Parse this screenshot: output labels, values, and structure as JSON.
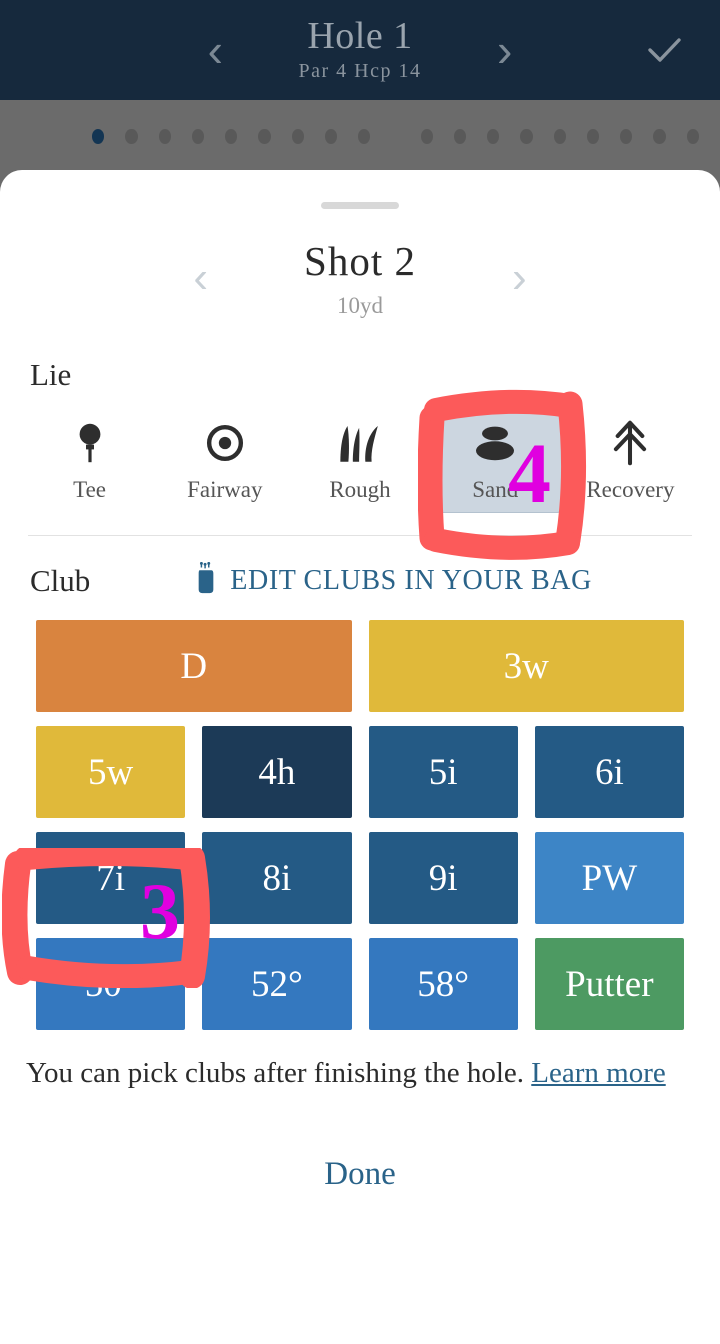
{
  "header": {
    "hole_title": "Hole 1",
    "hole_sub": "Par 4  Hcp 14",
    "prev_icon": "chevron-left-icon",
    "next_icon": "chevron-right-icon",
    "confirm_icon": "check-icon",
    "bg_color": "#16293d",
    "text_color": "#9aa4ae"
  },
  "pager": {
    "total_front": 9,
    "total_back": 9,
    "active_index": 0,
    "active_color": "#133553",
    "inactive_color": "#595959"
  },
  "sheet": {
    "shot": {
      "title": "Shot 2",
      "distance": "10yd",
      "prev_icon": "chevron-left-icon",
      "next_icon": "chevron-right-icon"
    },
    "lie": {
      "label": "Lie",
      "selected": "Sand",
      "options": [
        {
          "label": "Tee",
          "icon": "golf-tee-icon"
        },
        {
          "label": "Fairway",
          "icon": "target-circle-icon"
        },
        {
          "label": "Rough",
          "icon": "grass-icon"
        },
        {
          "label": "Sand",
          "icon": "sand-bunker-icon"
        },
        {
          "label": "Recovery",
          "icon": "pine-tree-icon"
        }
      ]
    },
    "club": {
      "label": "Club",
      "edit_link": "EDIT CLUBS IN YOUR BAG",
      "edit_icon": "golf-bag-icon",
      "edit_color": "#2a6389",
      "rows": [
        [
          {
            "label": "D",
            "color": "#d9843f"
          },
          {
            "label": "3w",
            "color": "#e0b93a"
          }
        ],
        [
          {
            "label": "5w",
            "color": "#e0b93a"
          },
          {
            "label": "4h",
            "color": "#1c3a57"
          },
          {
            "label": "5i",
            "color": "#245a85"
          },
          {
            "label": "6i",
            "color": "#245a85"
          }
        ],
        [
          {
            "label": "7i",
            "color": "#245a85"
          },
          {
            "label": "8i",
            "color": "#245a85"
          },
          {
            "label": "9i",
            "color": "#245a85"
          },
          {
            "label": "PW",
            "color": "#3d85c6"
          }
        ],
        [
          {
            "label": "50°",
            "color": "#3478bf"
          },
          {
            "label": "52°",
            "color": "#3478bf"
          },
          {
            "label": "58°",
            "color": "#3478bf"
          },
          {
            "label": "Putter",
            "color": "#4d9a62"
          }
        ]
      ]
    },
    "note_text": "You can pick clubs after finishing the hole. ",
    "note_link": "Learn more",
    "done_label": "Done"
  },
  "annotations": {
    "color": "#fc5a5a",
    "number_color": "#e000e0",
    "marks": [
      {
        "number": "4",
        "target": "Sand"
      },
      {
        "number": "3",
        "target": "7i"
      }
    ]
  }
}
